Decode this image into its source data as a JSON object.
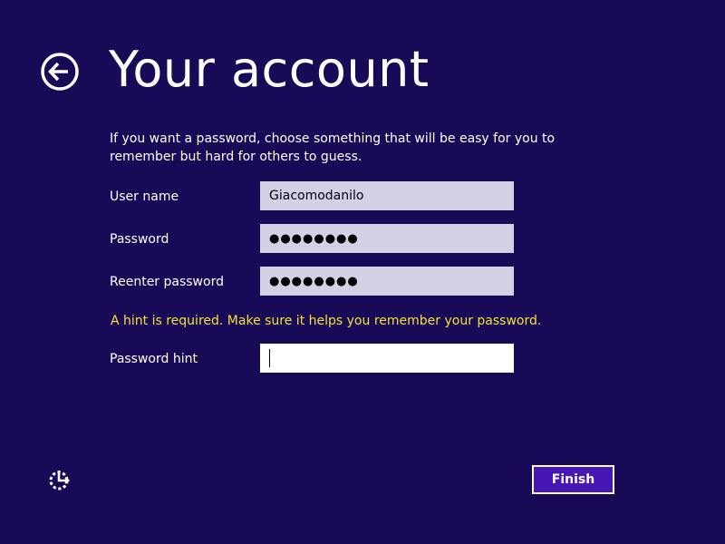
{
  "header": {
    "title": "Your account",
    "back_icon": "back-arrow-circle-icon"
  },
  "description": "If you want a password, choose something that will be easy for you to remember but hard for others to guess.",
  "form": {
    "username": {
      "label": "User name",
      "value": "Giacomodanilo"
    },
    "password": {
      "label": "Password",
      "value": "●●●●●●●●"
    },
    "reenter_password": {
      "label": "Reenter password",
      "value": "●●●●●●●●"
    },
    "hint_warning": "A hint is required. Make sure it helps you remember your password.",
    "password_hint": {
      "label": "Password hint",
      "value": ""
    }
  },
  "footer": {
    "ease_of_access_icon": "ease-of-access-icon",
    "finish_label": "Finish"
  },
  "colors": {
    "background": "#180a57",
    "input_background": "#d4d0e5",
    "active_input_background": "#ffffff",
    "warning_text": "#f3e23a",
    "button_background": "#4617b4"
  }
}
